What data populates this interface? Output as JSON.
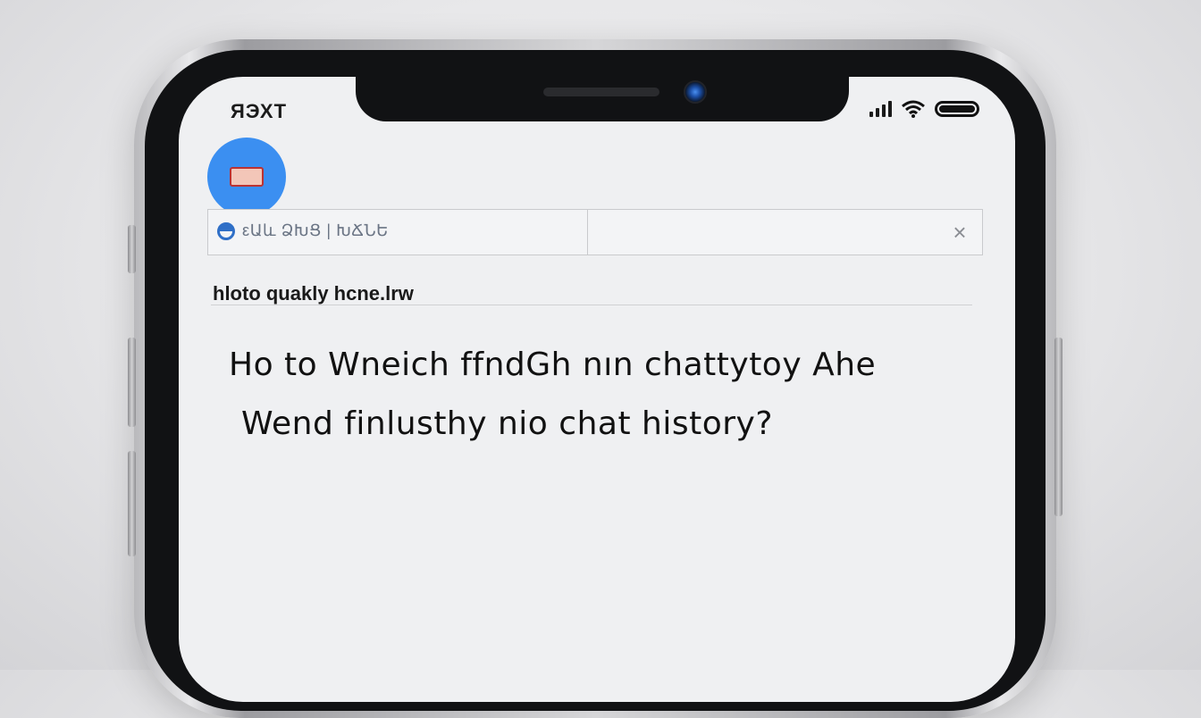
{
  "status_bar": {
    "time": "ЯЭХТ"
  },
  "search": {
    "text": "ԑԱև ՁԽՑ | ԽՃՆԵ",
    "close_symbol": "×"
  },
  "subheading": "hloto quakly hcne.lrw",
  "question": {
    "line1": "Ho to Wneich ffndGh nın chattytoy Ahe",
    "line2": "Wend finlusthy nio chat history?"
  },
  "colors": {
    "accent": "#3b8ff1",
    "screen_bg": "#eff0f2"
  },
  "icons": [
    "avatar-icon",
    "search-icon",
    "close-icon",
    "signal-icon",
    "wifi-icon",
    "battery-icon"
  ]
}
